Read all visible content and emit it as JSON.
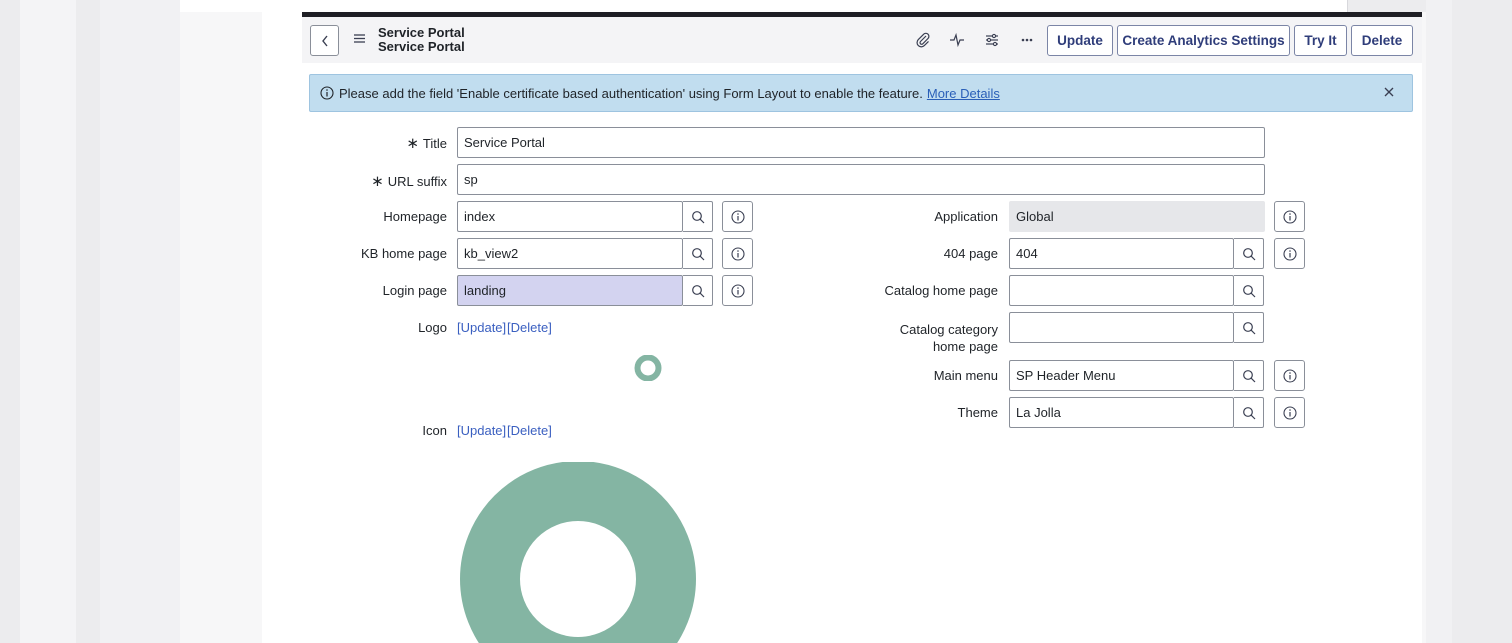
{
  "header": {
    "title_line1": "Service Portal",
    "title_line2": "Service Portal",
    "buttons": {
      "update": "Update",
      "create_analytics": "Create Analytics Settings",
      "try_it": "Try It",
      "delete": "Delete"
    },
    "icons": [
      "paperclip-icon",
      "activity-icon",
      "settings-sliders-icon",
      "more-icon"
    ]
  },
  "banner": {
    "message": "Please add the field 'Enable certificate based authentication' using Form Layout to enable the feature.",
    "link": "More Details"
  },
  "form": {
    "title": {
      "label": "Title",
      "value": "Service Portal"
    },
    "url_suffix": {
      "label": "URL suffix",
      "value": "sp"
    },
    "homepage": {
      "label": "Homepage",
      "value": "index"
    },
    "kb_home_page": {
      "label": "KB home page",
      "value": "kb_view2"
    },
    "login_page": {
      "label": "Login page",
      "value": "landing"
    },
    "logo": {
      "label": "Logo",
      "update": "[Update]",
      "delete": "[Delete]"
    },
    "icon": {
      "label": "Icon",
      "update": "[Update]",
      "delete": "[Delete]"
    },
    "application": {
      "label": "Application",
      "value": "Global"
    },
    "page_404": {
      "label": "404 page",
      "value": "404"
    },
    "catalog_home_page": {
      "label": "Catalog home page",
      "value": ""
    },
    "catalog_category_home_page": {
      "label_line1": "Catalog category",
      "label_line2": "home page",
      "value": ""
    },
    "main_menu": {
      "label": "Main menu",
      "value": "SP Header Menu"
    },
    "theme": {
      "label": "Theme",
      "value": "La Jolla"
    }
  },
  "colors": {
    "accent": "#2f3d7a",
    "banner_bg": "#c1ddef",
    "logo_color": "#84b5a3",
    "highlight_field": "#d3d3f0"
  }
}
